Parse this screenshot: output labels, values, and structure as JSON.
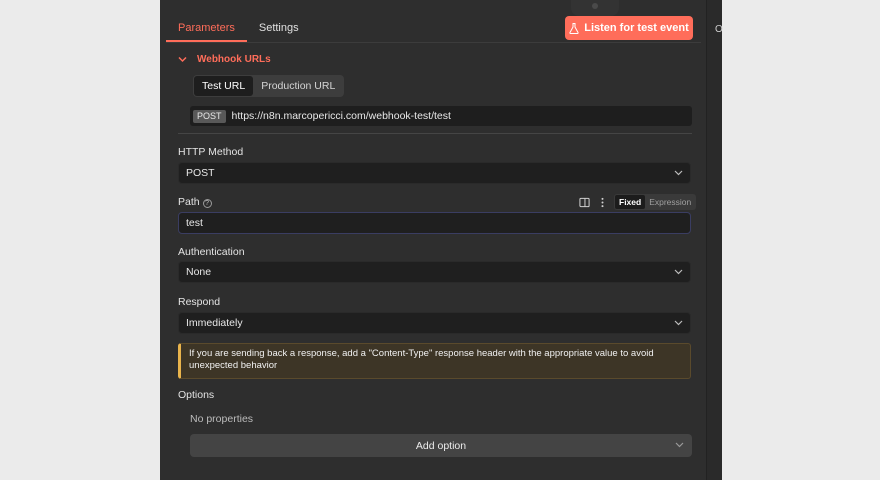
{
  "tabs": [
    {
      "label": "Parameters",
      "active": true
    },
    {
      "label": "Settings",
      "active": false
    }
  ],
  "listen_button": {
    "label": "Listen for test event",
    "icon": "flask-icon"
  },
  "right_strip_text": "O",
  "webhook": {
    "section_label": "Webhook URLs",
    "url_tabs": [
      {
        "label": "Test URL",
        "active": true
      },
      {
        "label": "Production URL",
        "active": false
      }
    ],
    "method": "POST",
    "url": "https://n8n.marcopericci.com/webhook-test/test"
  },
  "fields": {
    "http_method": {
      "label": "HTTP Method",
      "value": "POST"
    },
    "path": {
      "label": "Path",
      "help": "?",
      "value": "test",
      "mode_options": [
        "Fixed",
        "Expression"
      ],
      "mode_selected": "Fixed"
    },
    "authentication": {
      "label": "Authentication",
      "value": "None"
    },
    "respond": {
      "label": "Respond",
      "value": "Immediately"
    }
  },
  "notice": "If you are sending back a response, add a \"Content-Type\" response header with the appropriate value to avoid unexpected behavior",
  "options": {
    "label": "Options",
    "empty_text": "No properties",
    "add_label": "Add option"
  },
  "colors": {
    "accent": "#ff6d5a",
    "panel_bg": "#2e2e2e",
    "input_bg": "#1f1f1f",
    "warning": "#e9b44c"
  }
}
